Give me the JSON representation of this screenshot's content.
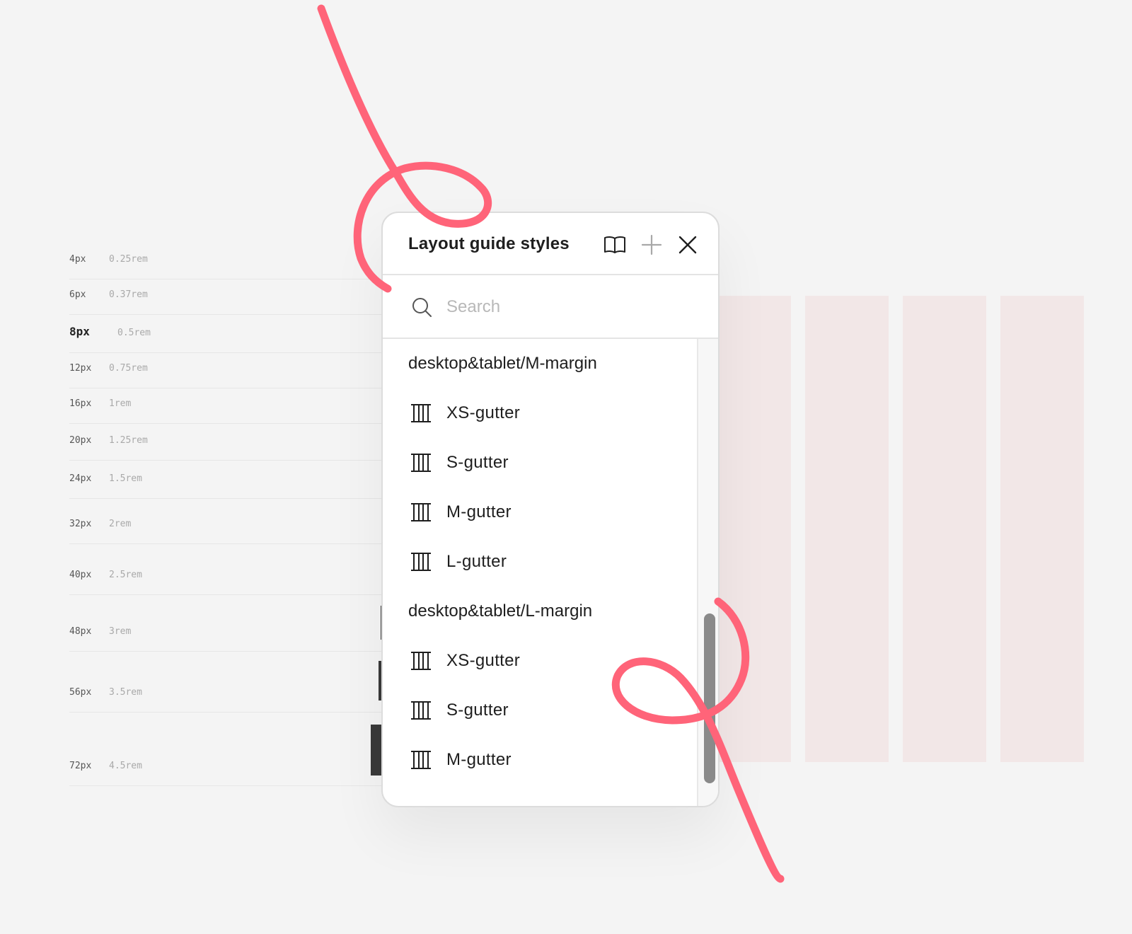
{
  "spacing_scale": [
    {
      "px": "4px",
      "rem": "0.25rem",
      "active": false,
      "bar": false
    },
    {
      "px": "6px",
      "rem": "0.37rem",
      "active": false,
      "bar": false
    },
    {
      "px": "8px",
      "rem": "0.5rem",
      "active": true,
      "bar": false
    },
    {
      "px": "12px",
      "rem": "0.75rem",
      "active": false,
      "bar": false
    },
    {
      "px": "16px",
      "rem": "1rem",
      "active": false,
      "bar": false
    },
    {
      "px": "20px",
      "rem": "1.25rem",
      "active": false,
      "bar": false
    },
    {
      "px": "24px",
      "rem": "1.5rem",
      "active": false,
      "bar": false
    },
    {
      "px": "32px",
      "rem": "2rem",
      "active": false,
      "bar": false
    },
    {
      "px": "40px",
      "rem": "2.5rem",
      "active": false,
      "bar": true
    },
    {
      "px": "48px",
      "rem": "3rem",
      "active": false,
      "bar": true
    },
    {
      "px": "56px",
      "rem": "3.5rem",
      "active": false,
      "bar": true
    },
    {
      "px": "72px",
      "rem": "4.5rem",
      "active": false,
      "bar": true
    }
  ],
  "panel": {
    "title": "Layout guide styles",
    "icons": {
      "library": "book-icon",
      "add": "plus-icon",
      "close": "close-icon"
    },
    "search": {
      "placeholder": "Search",
      "value": ""
    },
    "groups": [
      {
        "name": "desktop&tablet/M-margin",
        "items": [
          "XS-gutter",
          "S-gutter",
          "M-gutter",
          "L-gutter"
        ]
      },
      {
        "name": "desktop&tablet/L-margin",
        "items": [
          "XS-gutter",
          "S-gutter",
          "M-gutter"
        ]
      }
    ],
    "item_icon": "column-grid-icon"
  },
  "colors": {
    "background": "#f4f4f4",
    "ribbon": "#ff6479",
    "column_guide": "#f2e7e7",
    "scrollbar_thumb": "#8a8a8a",
    "text": "#1e1e1e"
  }
}
